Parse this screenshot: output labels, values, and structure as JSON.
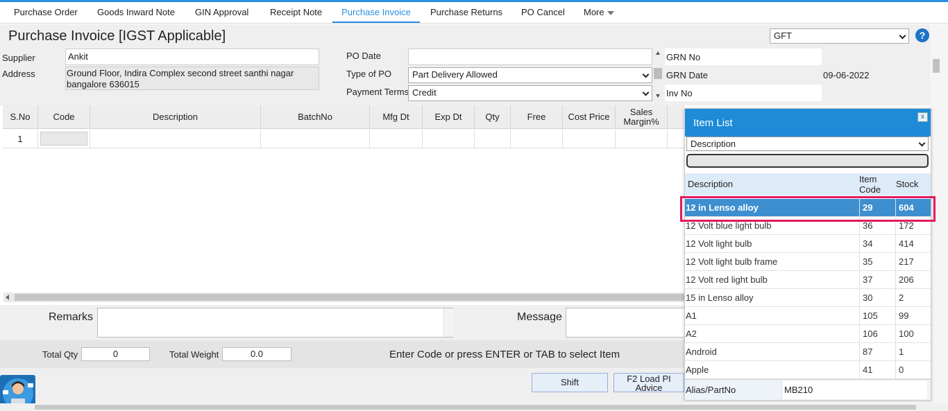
{
  "tabs": [
    {
      "label": "Purchase Order"
    },
    {
      "label": "Goods Inward Note"
    },
    {
      "label": "GIN Approval"
    },
    {
      "label": "Receipt Note"
    },
    {
      "label": "Purchase Invoice"
    },
    {
      "label": "Purchase Returns"
    },
    {
      "label": "PO Cancel"
    },
    {
      "label": "More"
    }
  ],
  "page_title": "Purchase Invoice [IGST Applicable]",
  "company_select": "GFT",
  "help_icon_label": "?",
  "form": {
    "supplier_label": "Supplier",
    "supplier_value": "Ankit",
    "address_label": "Address",
    "address_line1": "Ground Floor, Indira Complex second street santhi nagar",
    "address_line2": "bangalore 636015",
    "po_date_label": "PO Date",
    "po_date_value": "",
    "type_of_po_label": "Type of PO",
    "type_of_po_value": "Part Delivery Allowed",
    "payment_terms_label": "Payment Terms",
    "payment_terms_value": "Credit",
    "grn_no_label": "GRN No",
    "grn_no_value": "",
    "grn_date_label": "GRN Date",
    "grn_date_value": "09-06-2022",
    "inv_no_label": "Inv No",
    "inv_no_value": ""
  },
  "grid": {
    "columns": [
      "S.No",
      "Code",
      "Description",
      "BatchNo",
      "Mfg Dt",
      "Exp Dt",
      "Qty",
      "Free",
      "Cost Price",
      "Sales Margin%"
    ],
    "rows": [
      {
        "sno": "1"
      }
    ]
  },
  "bottom": {
    "remarks_label": "Remarks",
    "message_label": "Message",
    "total_qty_label": "Total Qty",
    "total_qty_value": "0",
    "total_weight_label": "Total Weight",
    "total_weight_value": "0.0",
    "hint": "Enter Code or press ENTER or TAB to select Item",
    "shift_button": "Shift",
    "f2_button_line1": "F2 Load PI",
    "f2_button_line2": "Advice"
  },
  "item_list": {
    "title": "Item List",
    "close_label": "x",
    "search_by": "Description",
    "headers": {
      "description": "Description",
      "item_code_line1": "Item",
      "item_code_line2": "Code",
      "stock": "Stock"
    },
    "items": [
      {
        "description": "12 in Lenso alloy",
        "code": "29",
        "stock": "604"
      },
      {
        "description": "12 Volt blue light bulb",
        "code": "36",
        "stock": "172"
      },
      {
        "description": "12 Volt light bulb",
        "code": "34",
        "stock": "414"
      },
      {
        "description": "12 Volt light bulb frame",
        "code": "35",
        "stock": "217"
      },
      {
        "description": "12 Volt red light bulb",
        "code": "37",
        "stock": "206"
      },
      {
        "description": "15 in Lenso alloy",
        "code": "30",
        "stock": "2"
      },
      {
        "description": "A1",
        "code": "105",
        "stock": "99"
      },
      {
        "description": "A2",
        "code": "106",
        "stock": "100"
      },
      {
        "description": "Android",
        "code": "87",
        "stock": "1"
      },
      {
        "description": "Apple",
        "code": "41",
        "stock": "0"
      }
    ],
    "selected_index": 0,
    "alias_label": "Alias/PartNo",
    "alias_value": "MB210"
  }
}
